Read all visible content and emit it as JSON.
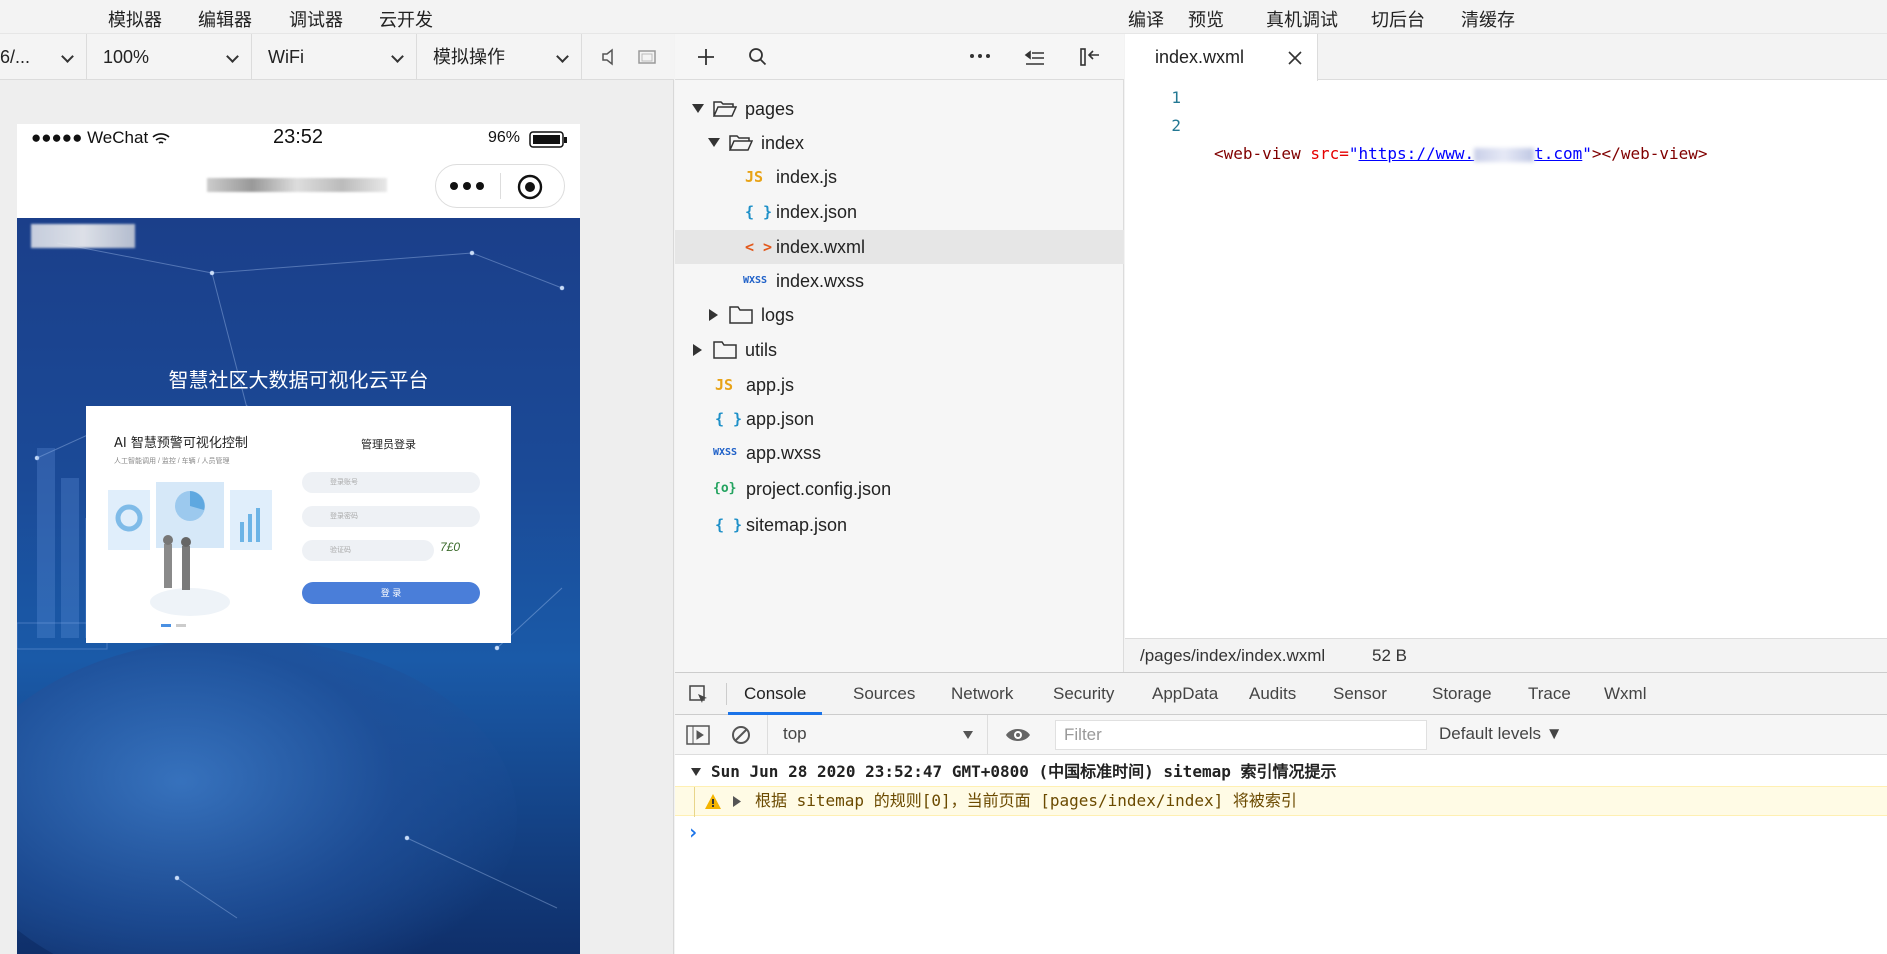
{
  "menubar": {
    "left_items": [
      "模拟器",
      "编辑器",
      "调试器",
      "云开发"
    ],
    "right_items": [
      "编译",
      "预览",
      "真机调试",
      "切后台",
      "清缓存"
    ]
  },
  "simulator": {
    "device_select": "6/...",
    "zoom_select": "100%",
    "network_select": "WiFi",
    "action_select": "模拟操作",
    "status": {
      "carrier": "●●●●● WeChat",
      "time": "23:52",
      "battery": "96%"
    },
    "web_title": "智慧社区大数据可视化云平台",
    "login_card": {
      "left_title": "AI 智慧预警可视化控制",
      "left_subtitle": "人工智能调用 / 监控 / 车辆 / 人员管理",
      "right_title": "管理员登录",
      "account_placeholder": "登录账号",
      "password_placeholder": "登录密码",
      "captcha_placeholder": "验证码",
      "captcha_text": "7£0",
      "login_button": "登 录"
    }
  },
  "file_tree": {
    "items": [
      {
        "name": "pages",
        "type": "folder-open",
        "depth": 0
      },
      {
        "name": "index",
        "type": "folder-open",
        "depth": 1
      },
      {
        "name": "index.js",
        "type": "js",
        "depth": 2
      },
      {
        "name": "index.json",
        "type": "json",
        "depth": 2
      },
      {
        "name": "index.wxml",
        "type": "wxml",
        "depth": 2,
        "selected": true
      },
      {
        "name": "index.wxss",
        "type": "wxss",
        "depth": 2
      },
      {
        "name": "logs",
        "type": "folder",
        "depth": 1
      },
      {
        "name": "utils",
        "type": "folder",
        "depth": 0
      },
      {
        "name": "app.js",
        "type": "js",
        "depth": 0
      },
      {
        "name": "app.json",
        "type": "json",
        "depth": 0
      },
      {
        "name": "app.wxss",
        "type": "wxss",
        "depth": 0
      },
      {
        "name": "project.config.json",
        "type": "config",
        "depth": 0
      },
      {
        "name": "sitemap.json",
        "type": "json",
        "depth": 0
      }
    ]
  },
  "editor": {
    "tab_label": "index.wxml",
    "lines": [
      {
        "num": "1",
        "tag_open": "<web-view",
        "attr": " src=",
        "q1": "\"",
        "url": "https://www.",
        "url_end": "t.com",
        "q2": "\"",
        "tag_close": "></web-view>"
      },
      {
        "num": "2"
      }
    ],
    "path": "/pages/index/index.wxml",
    "size": "52 B"
  },
  "devtools": {
    "tabs": [
      "Console",
      "Sources",
      "Network",
      "Security",
      "AppData",
      "Audits",
      "Sensor",
      "Storage",
      "Trace",
      "Wxml"
    ],
    "active_tab": "Console",
    "context": "top",
    "filter_placeholder": "Filter",
    "levels": "Default levels ▼",
    "log_header": "Sun Jun 28 2020 23:52:47 GMT+0800 (中国标准时间) sitemap 索引情况提示",
    "log_warning": "根据 sitemap 的规则[0]，当前页面 [pages/index/index] 将被索引",
    "prompt": "›"
  },
  "colors": {
    "accent": "#1a73e8",
    "js": "#e8a317",
    "json": "#1e90c8",
    "wxml": "#e2581b",
    "wxss": "#1e60c8",
    "config": "#23a35f"
  }
}
